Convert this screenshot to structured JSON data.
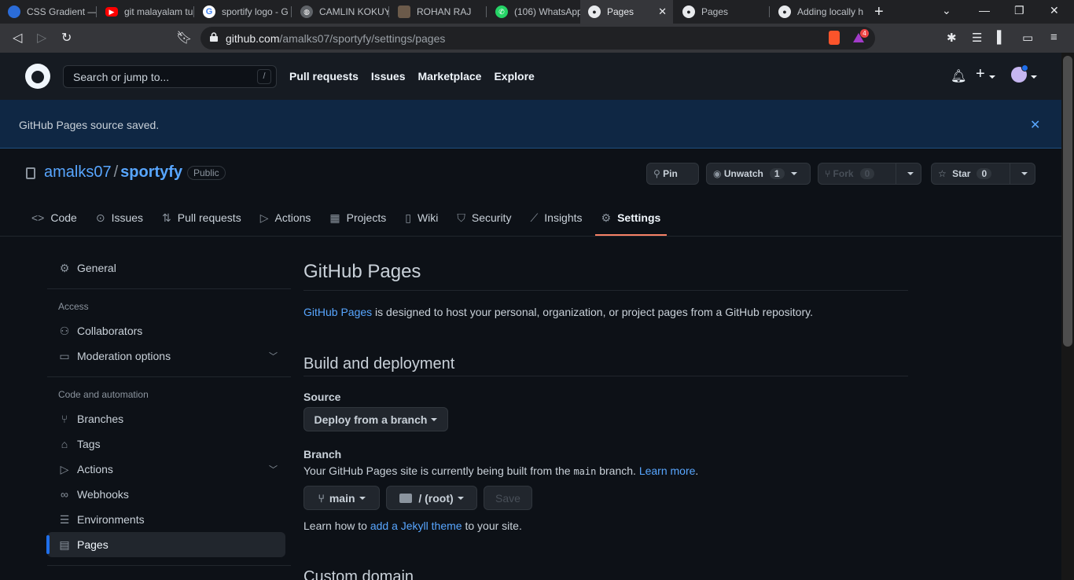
{
  "browser": {
    "tabs": [
      {
        "title": "CSS Gradient —",
        "icon": "css-gradient-icon"
      },
      {
        "title": "git malayalam tu",
        "icon": "youtube-icon"
      },
      {
        "title": "sportify logo - G",
        "icon": "google-icon"
      },
      {
        "title": "CAMLIN KOKUY",
        "icon": "globe-icon"
      },
      {
        "title": "ROHAN RAJ",
        "icon": "profile-icon"
      },
      {
        "title": "(106) WhatsApp",
        "icon": "whatsapp-icon"
      },
      {
        "title": "Pages",
        "icon": "github-icon"
      },
      {
        "title": "Pages",
        "icon": "github-icon"
      },
      {
        "title": "Adding locally h",
        "icon": "github-icon"
      }
    ],
    "url_host": "github.com",
    "url_path": "/amalks07/sportyfy/settings/pages",
    "brave_badge": "4"
  },
  "header": {
    "search_placeholder": "Search or jump to...",
    "search_shortcut": "/",
    "nav": [
      "Pull requests",
      "Issues",
      "Marketplace",
      "Explore"
    ]
  },
  "flash": {
    "message": "GitHub Pages source saved."
  },
  "repo": {
    "owner": "amalks07",
    "name": "sportyfy",
    "visibility": "Public",
    "pin_label": "Pin",
    "watch_label": "Unwatch",
    "watch_count": "1",
    "fork_label": "Fork",
    "fork_count": "0",
    "star_label": "Star",
    "star_count": "0"
  },
  "repo_tabs": [
    {
      "label": "Code",
      "icon": "code-icon"
    },
    {
      "label": "Issues",
      "icon": "issue-icon"
    },
    {
      "label": "Pull requests",
      "icon": "pull-request-icon"
    },
    {
      "label": "Actions",
      "icon": "play-icon"
    },
    {
      "label": "Projects",
      "icon": "table-icon"
    },
    {
      "label": "Wiki",
      "icon": "book-icon"
    },
    {
      "label": "Security",
      "icon": "shield-icon"
    },
    {
      "label": "Insights",
      "icon": "graph-icon"
    },
    {
      "label": "Settings",
      "icon": "gear-icon",
      "selected": true
    }
  ],
  "sidebar": {
    "general": "General",
    "access_heading": "Access",
    "collaborators": "Collaborators",
    "moderation": "Moderation options",
    "code_heading": "Code and automation",
    "branches": "Branches",
    "tags": "Tags",
    "actions": "Actions",
    "webhooks": "Webhooks",
    "environments": "Environments",
    "pages": "Pages"
  },
  "main": {
    "title": "GitHub Pages",
    "desc_link": "GitHub Pages",
    "desc_rest": " is designed to host your personal, organization, or project pages from a GitHub repository.",
    "build_heading": "Build and deployment",
    "source_label": "Source",
    "source_value": "Deploy from a branch",
    "branch_label": "Branch",
    "branch_text_1": "Your GitHub Pages site is currently being built from the ",
    "branch_code": "main",
    "branch_text_2": " branch. ",
    "learn_more": "Learn more",
    "branch_value": "main",
    "folder_value": "/ (root)",
    "save_label": "Save",
    "jekyll_1": "Learn how to ",
    "jekyll_link": "add a Jekyll theme",
    "jekyll_2": " to your site.",
    "custom_domain_heading": "Custom domain"
  }
}
